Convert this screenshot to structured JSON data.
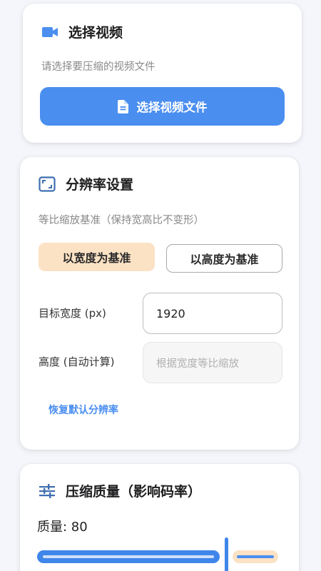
{
  "select_video": {
    "title": "选择视频",
    "hint": "请选择要压缩的视频文件",
    "button_label": "选择视频文件",
    "icon": "video-camera-icon",
    "button_icon": "file-icon"
  },
  "resolution": {
    "title": "分辨率设置",
    "icon": "aspect-ratio-icon",
    "hint": "等比缩放基准（保持宽高比不变形）",
    "options": [
      "以宽度为基准",
      "以高度为基准"
    ],
    "selected_option": "以宽度为基准",
    "width_label": "目标宽度 (px)",
    "width_value": "1920",
    "height_label": "高度 (自动计算)",
    "height_placeholder": "根据宽度等比缩放",
    "reset_label": "恢复默认分辨率"
  },
  "quality": {
    "title": "压缩质量（影响码率）",
    "icon": "sliders-icon",
    "label": "质量: 80",
    "value": 80
  },
  "colors": {
    "accent": "#4a8ef0",
    "selected_bg": "#fbe2c5",
    "background": "#f4f6fb"
  }
}
